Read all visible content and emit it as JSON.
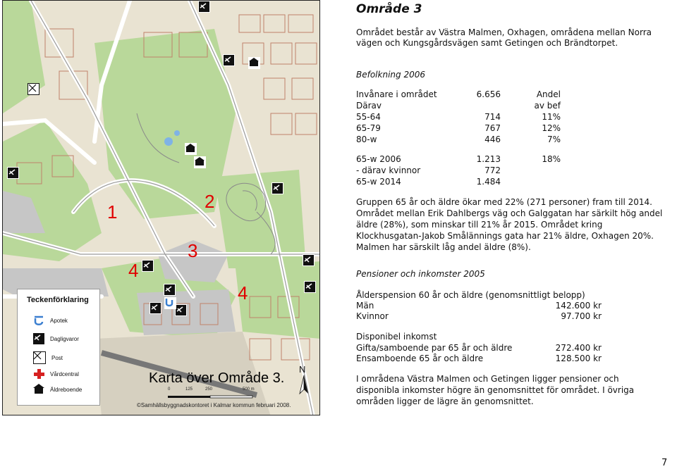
{
  "map": {
    "area_numbers": [
      "1",
      "2",
      "3",
      "4",
      "4"
    ],
    "legend": {
      "title": "Teckenförklaring",
      "items": [
        {
          "label": "Apotek",
          "icon": "pharmacy-icon"
        },
        {
          "label": "Dagligvaror",
          "icon": "grocery-icon"
        },
        {
          "label": "Post",
          "icon": "post-icon"
        },
        {
          "label": "Vårdcentral",
          "icon": "healthcare-icon"
        },
        {
          "label": "Äldreboende",
          "icon": "elderly-home-icon"
        }
      ]
    },
    "title": "Karta över Område 3.",
    "scale": [
      "0",
      "125",
      "250",
      "500 m"
    ],
    "north": "N",
    "credit": "©Samhällsbyggnadskontoret i Kalmar kommun februari 2008.",
    "colors": {
      "green": "#b9d89a",
      "built": "#e9e3d2",
      "road": "#ffffff",
      "red": "#e00000"
    }
  },
  "heading": "Område 3",
  "intro": [
    "Området består av Västra Malmen, Oxhagen, områdena mellan Norra",
    "vägen och Kungsgårdsvägen samt Getingen och Brändtorpet."
  ],
  "pop": {
    "title": "Befolkning 2006",
    "rows": [
      {
        "label": "Invånare i området",
        "value": "6.656",
        "pct": "Andel"
      },
      {
        "label": "Därav",
        "value": "",
        "pct": "av bef"
      },
      {
        "label": "55-64",
        "value": "714",
        "pct": "11%"
      },
      {
        "label": "65-79",
        "value": "767",
        "pct": "12%"
      },
      {
        "label": "80-w",
        "value": "446",
        "pct": "7%"
      },
      {
        "label": "65-w 2006",
        "value": "1.213",
        "pct": "18%"
      },
      {
        "label": "- därav kvinnor",
        "value": "772",
        "pct": ""
      },
      {
        "label": "65-w 2014",
        "value": "1.484",
        "pct": ""
      }
    ],
    "paragraph": [
      "Gruppen 65 år och äldre ökar med 22% (271 personer) fram till 2014.",
      "Området mellan Erik Dahlbergs väg och Galggatan har särkilt hög andel",
      "äldre (28%), som minskar till 21% år 2015. Området kring",
      "Klockhusgatan-Jakob Smålännings gata har 21% äldre, Oxhagen 20%.",
      "Malmen har särskilt låg andel äldre (8%)."
    ]
  },
  "income": {
    "title": "Pensioner och inkomster 2005",
    "pension_title": "Ålderspension 60 år och äldre (genomsnittligt belopp)",
    "pension_rows": [
      {
        "label": "Män",
        "value": "142.600 kr"
      },
      {
        "label": "Kvinnor",
        "value": "97.700 kr"
      }
    ],
    "disp_title": "Disponibel inkomst",
    "disp_rows": [
      {
        "label": "Gifta/samboende par 65 år och äldre",
        "value": "272.400 kr"
      },
      {
        "label": "Ensamboende 65 år och äldre",
        "value": "128.500 kr"
      }
    ],
    "paragraph": [
      "I områdena Västra Malmen och Getingen ligger pensioner och",
      "disponibla inkomster högre än genomsnittet för området. I övriga",
      "områden ligger de lägre än genomsnittet."
    ]
  },
  "page_number": "7"
}
